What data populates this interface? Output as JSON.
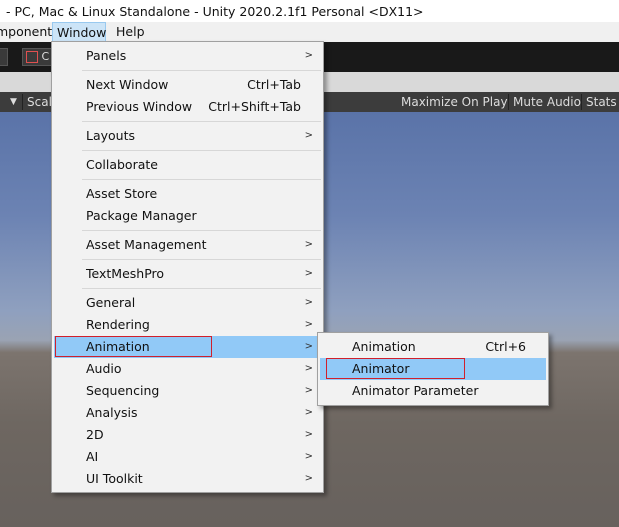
{
  "title_bar": {
    "text": "- PC, Mac & Linux Standalone - Unity 2020.2.1f1 Personal <DX11>"
  },
  "menubar": {
    "items": [
      "mponent",
      "Window",
      "Help"
    ]
  },
  "toolbar": {
    "cut_label": "C"
  },
  "game_view": {
    "scale_label": "Scal",
    "maximize_label": "Maximize On Play",
    "mute_label": "Mute Audio",
    "stats_label": "Stats"
  },
  "window_menu": {
    "items": [
      {
        "label": "Panels",
        "shortcut": "",
        "submenu": true
      },
      {
        "label": "Next Window",
        "shortcut": "Ctrl+Tab",
        "submenu": false
      },
      {
        "label": "Previous Window",
        "shortcut": "Ctrl+Shift+Tab",
        "submenu": false
      },
      {
        "label": "Layouts",
        "shortcut": "",
        "submenu": true
      },
      {
        "label": "Collaborate",
        "shortcut": "",
        "submenu": false
      },
      {
        "label": "Asset Store",
        "shortcut": "",
        "submenu": false
      },
      {
        "label": "Package Manager",
        "shortcut": "",
        "submenu": false
      },
      {
        "label": "Asset Management",
        "shortcut": "",
        "submenu": true
      },
      {
        "label": "TextMeshPro",
        "shortcut": "",
        "submenu": true
      },
      {
        "label": "General",
        "shortcut": "",
        "submenu": true
      },
      {
        "label": "Rendering",
        "shortcut": "",
        "submenu": true
      },
      {
        "label": "Animation",
        "shortcut": "",
        "submenu": true,
        "highlighted": true
      },
      {
        "label": "Audio",
        "shortcut": "",
        "submenu": true
      },
      {
        "label": "Sequencing",
        "shortcut": "",
        "submenu": true
      },
      {
        "label": "Analysis",
        "shortcut": "",
        "submenu": true
      },
      {
        "label": "2D",
        "shortcut": "",
        "submenu": true
      },
      {
        "label": "AI",
        "shortcut": "",
        "submenu": true
      },
      {
        "label": "UI Toolkit",
        "shortcut": "",
        "submenu": true
      }
    ]
  },
  "animation_submenu": {
    "items": [
      {
        "label": "Animation",
        "shortcut": "Ctrl+6"
      },
      {
        "label": "Animator",
        "shortcut": "",
        "highlighted": true
      },
      {
        "label": "Animator Parameter",
        "shortcut": ""
      }
    ]
  },
  "colors": {
    "highlight": "#91c9f7",
    "annotation_box": "#d0202c"
  }
}
